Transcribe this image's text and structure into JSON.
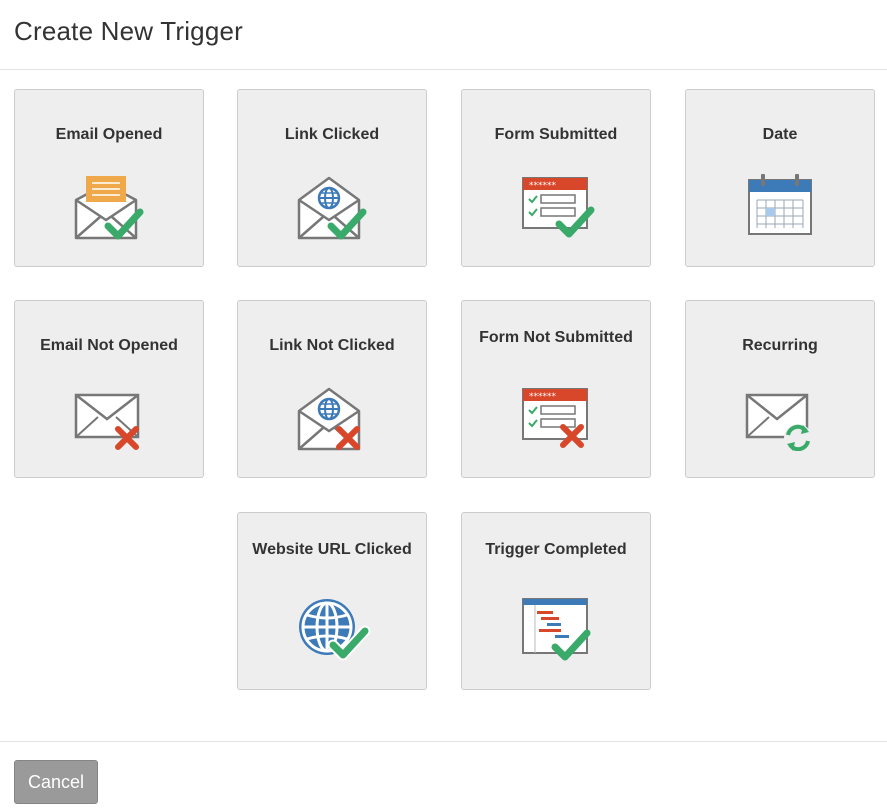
{
  "dialog": {
    "title": "Create New Trigger"
  },
  "triggers": [
    {
      "label": "Email Opened",
      "icon": "email-opened-icon"
    },
    {
      "label": "Link Clicked",
      "icon": "link-clicked-icon"
    },
    {
      "label": "Form Submitted",
      "icon": "form-submitted-icon"
    },
    {
      "label": "Date",
      "icon": "calendar-icon"
    },
    {
      "label": "Email Not Opened",
      "icon": "email-not-opened-icon"
    },
    {
      "label": "Link Not Clicked",
      "icon": "link-not-clicked-icon"
    },
    {
      "label": "Form Not Submitted",
      "icon": "form-not-submitted-icon"
    },
    {
      "label": "Recurring",
      "icon": "recurring-icon"
    },
    {
      "label": "Website URL Clicked",
      "icon": "globe-icon"
    },
    {
      "label": "Trigger Completed",
      "icon": "trigger-completed-icon"
    }
  ],
  "footer": {
    "cancel_label": "Cancel"
  },
  "colors": {
    "check_green": "#3aaa6a",
    "cross_red": "#d9472b",
    "globe_blue": "#3d7ab8",
    "envelope_gray": "#7a7a7a",
    "paper_orange": "#f0a94a"
  }
}
